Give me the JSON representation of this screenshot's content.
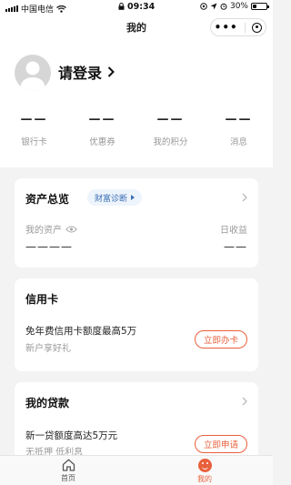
{
  "status_bar": {
    "carrier": "中国电信",
    "time": "09:34",
    "battery_percent": "30%",
    "battery_level": 0.3
  },
  "nav": {
    "title": "我的"
  },
  "profile": {
    "login_label": "请登录",
    "stats": [
      {
        "value": "——",
        "label": "银行卡"
      },
      {
        "value": "——",
        "label": "优惠券"
      },
      {
        "value": "——",
        "label": "我的积分"
      },
      {
        "value": "——",
        "label": "消息"
      }
    ]
  },
  "assets": {
    "title": "资产总览",
    "diagnosis_label": "财富诊断",
    "my_assets_label": "我的资产",
    "my_assets_value": "————",
    "daily_income_label": "日收益",
    "daily_income_value": "——"
  },
  "credit_card": {
    "title": "信用卡",
    "description": "免年费信用卡额度最高5万",
    "subtitle": "新户享好礼",
    "button_label": "立即办卡"
  },
  "loans": {
    "title": "我的贷款",
    "description": "新一贷额度高达5万元",
    "subtitle": "无抵押 低利息",
    "button_label": "立即申请"
  },
  "tabbar": {
    "items": [
      {
        "label": "首页",
        "icon": "home-icon"
      },
      {
        "label": "我的",
        "icon": "profile-face-icon"
      }
    ]
  },
  "colors": {
    "accent": "#e8603c",
    "tag_blue": "#3b6fb6"
  }
}
